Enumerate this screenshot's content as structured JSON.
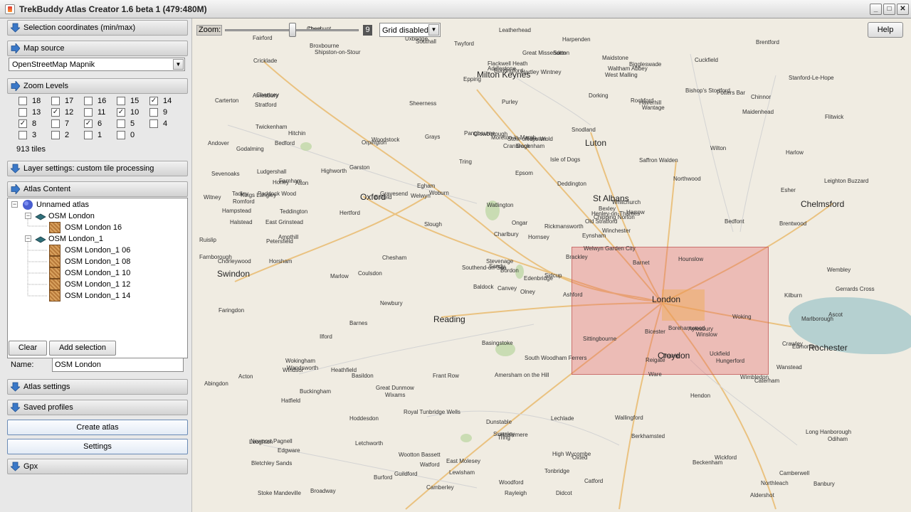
{
  "window": {
    "title": "TrekBuddy Atlas Creator 1.6 beta 1  (479:480M)"
  },
  "sections": {
    "selection_coords": "Selection coordinates (min/max)",
    "map_source": "Map source",
    "zoom_levels": "Zoom Levels",
    "layer_settings": "Layer settings: custom tile processing",
    "atlas_content": "Atlas Content",
    "atlas_settings": "Atlas settings",
    "saved_profiles": "Saved profiles",
    "gpx": "Gpx"
  },
  "map_source": {
    "selected": "OpenStreetMap Mapnik"
  },
  "zoom_levels": [
    {
      "level": "18",
      "checked": false
    },
    {
      "level": "17",
      "checked": false
    },
    {
      "level": "16",
      "checked": false
    },
    {
      "level": "15",
      "checked": false
    },
    {
      "level": "14",
      "checked": true
    },
    {
      "level": "13",
      "checked": false
    },
    {
      "level": "12",
      "checked": true
    },
    {
      "level": "11",
      "checked": false
    },
    {
      "level": "10",
      "checked": true
    },
    {
      "level": "9",
      "checked": false
    },
    {
      "level": "8",
      "checked": true
    },
    {
      "level": "7",
      "checked": false
    },
    {
      "level": "6",
      "checked": true
    },
    {
      "level": "5",
      "checked": false
    },
    {
      "level": "4",
      "checked": false
    },
    {
      "level": "3",
      "checked": false
    },
    {
      "level": "2",
      "checked": false
    },
    {
      "level": "1",
      "checked": false
    },
    {
      "level": "0",
      "checked": false
    }
  ],
  "tile_count": "913 tiles",
  "atlas_tree": {
    "root": "Unnamed atlas",
    "layer1": "OSM London",
    "layer1_maps": [
      "OSM London 16"
    ],
    "layer2": "OSM London_1",
    "layer2_maps": [
      "OSM London_1 06",
      "OSM London_1 08",
      "OSM London_1 10",
      "OSM London_1 12",
      "OSM London_1 14"
    ]
  },
  "buttons": {
    "clear": "Clear",
    "add_selection": "Add selection",
    "create_atlas": "Create atlas",
    "settings": "Settings",
    "help": "Help"
  },
  "name": {
    "label": "Name:",
    "value": "OSM London"
  },
  "map_controls": {
    "zoom_label": "Zoom:",
    "zoom_value": "9",
    "grid": "Grid disabled"
  },
  "map_places": {
    "big": [
      "London",
      "Reading",
      "Oxford",
      "Milton Keynes",
      "Luton",
      "St Albans",
      "Chelmsford",
      "Croydon",
      "Swindon",
      "Rochester"
    ],
    "towns": [
      "Olney",
      "Bedford",
      "Sandy",
      "Newport Pagnell",
      "Old Stratford",
      "Wixams",
      "Biggleswade",
      "Royston",
      "Haverhill",
      "Brackley",
      "Shipston-on-Stour",
      "Banbury",
      "Ampthill",
      "Flitwick",
      "Baldock",
      "Saffron Walden",
      "Broadway",
      "Moreton-in-Marsh",
      "Deddington",
      "Buckingham",
      "Woburn",
      "Bletchley Sands",
      "Letchworth",
      "Stow-on-the-Wold",
      "Chipping Norton",
      "Winslow",
      "Hitchin",
      "Buntingford",
      "Halstead",
      "Bicester",
      "Leighton Buzzard",
      "Stevenage",
      "Dunstable",
      "Charlbury",
      "Woodstock",
      "Bishop's Stortford",
      "Great Dunmow",
      "Northleach",
      "Long Hanborough",
      "Aylesbury",
      "Harpenden",
      "Welwyn",
      "Hertford",
      "Ware",
      "Burford",
      "Witney",
      "Eynsham",
      "Stoke Mandeville",
      "Tring",
      "Welwyn Garden City",
      "Hatfield",
      "Harlow",
      "Carterton",
      "Thame",
      "Berkhamsted",
      "Hoddesdon",
      "Broxbourne",
      "Fairford",
      "Lechlade",
      "Chinnor",
      "Great Missenden",
      "Chesham",
      "Kings Langley",
      "Garston",
      "Potters Bar",
      "Cheshunt",
      "Waltham Abbey",
      "Epping",
      "Ongar",
      "Abingdon",
      "Amersham on the Hill",
      "Watford",
      "Borehamwood",
      "Enfield",
      "Loughton",
      "Cricklade",
      "Highworth",
      "Faringdon",
      "Watlington",
      "High Wycombe",
      "Rickmansworth",
      "Edgware",
      "Barnet",
      "Edmonton",
      "Woodford",
      "Brentwood",
      "South Woodham Ferrers",
      "Wickford",
      "Didcot",
      "Wallingford",
      "Flackwell Heath",
      "Gerrards Cross",
      "Harrow",
      "Hendon",
      "Hornsey",
      "Wanstead",
      "Romford",
      "Rayleigh",
      "Rochford",
      "Wantage",
      "Marlow",
      "Uxbridge",
      "Wembley",
      "Hampstead",
      "Ilford",
      "Basildon",
      "Wootton Bassett",
      "Henley-on-Thames",
      "Maidenhead",
      "Slough",
      "Kilburn",
      "Stratford",
      "Dagenham",
      "Southend-on-Sea",
      "Southall",
      "Acton",
      "Canvey",
      "Stanford-Le-Hope",
      "Pangbourne",
      "Twyford",
      "Windsor",
      "Brentford",
      "Isle of Dogs",
      "Grays",
      "Hounslow",
      "Barnes",
      "Camberwell",
      "Lewisham",
      "Bedfont",
      "Twickenham",
      "Wandsworth",
      "Catford",
      "Gravesend",
      "Sheerness",
      "Marlborough",
      "Hungerford",
      "Newbury",
      "Wokingham",
      "Ascot",
      "Egham",
      "Ashford",
      "Teddington",
      "Wimbledon",
      "Sidcup",
      "Bexley",
      "Chertsey",
      "East Molesey",
      "Beckenham",
      "Swanley",
      "Addlestone",
      "Esher",
      "Orpington",
      "Tadley",
      "Camberley",
      "Woking",
      "Sutton",
      "Purley",
      "Epsom",
      "Coulsdon",
      "Snodland",
      "Sittingbourne",
      "Hartley Wintney",
      "Farnborough",
      "Leatherhead",
      "West Malling",
      "Ludgershall",
      "Basingstoke",
      "Odiham",
      "Fleet",
      "Aldershot",
      "Caterham",
      "Oxted",
      "Sevenoaks",
      "Maidstone",
      "Whitchurch",
      "Guildford",
      "Dorking",
      "Reigate",
      "Andover",
      "Farnham",
      "Godalming",
      "Edenbridge",
      "Tonbridge",
      "Paddock Wood",
      "Amesbury",
      "Alton",
      "Horley",
      "East Grinstead",
      "Royal Tunbridge Wells",
      "Bordon",
      "Crawley",
      "Frant Row",
      "Cranbrook",
      "Wilton",
      "Winchester",
      "Haslemere",
      "Horsham",
      "Crowborough",
      "Uckfield",
      "Heathfield",
      "Petersfield",
      "Cuckfield",
      "Tring",
      "Ruislip",
      "Northwood",
      "Chorleywood"
    ]
  }
}
